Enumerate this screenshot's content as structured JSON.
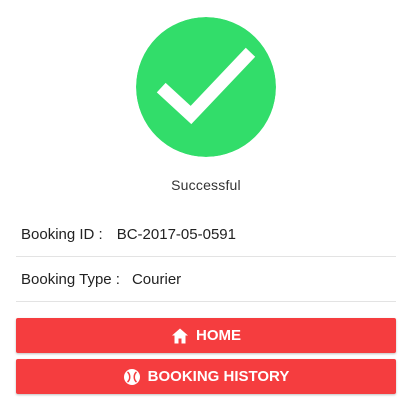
{
  "status": {
    "icon": "check-circle-icon",
    "text": "Successful",
    "color": "#32dd6a"
  },
  "booking": {
    "id_label": "Booking ID :",
    "id_value": "BC-2017-05-0591",
    "type_label": "Booking Type :",
    "type_value": "Courier"
  },
  "actions": {
    "home_label": "HOME",
    "home_icon": "home-icon",
    "history_label": "BOOKING HISTORY",
    "history_icon": "history-ball-icon",
    "button_color": "#f53d3f"
  }
}
